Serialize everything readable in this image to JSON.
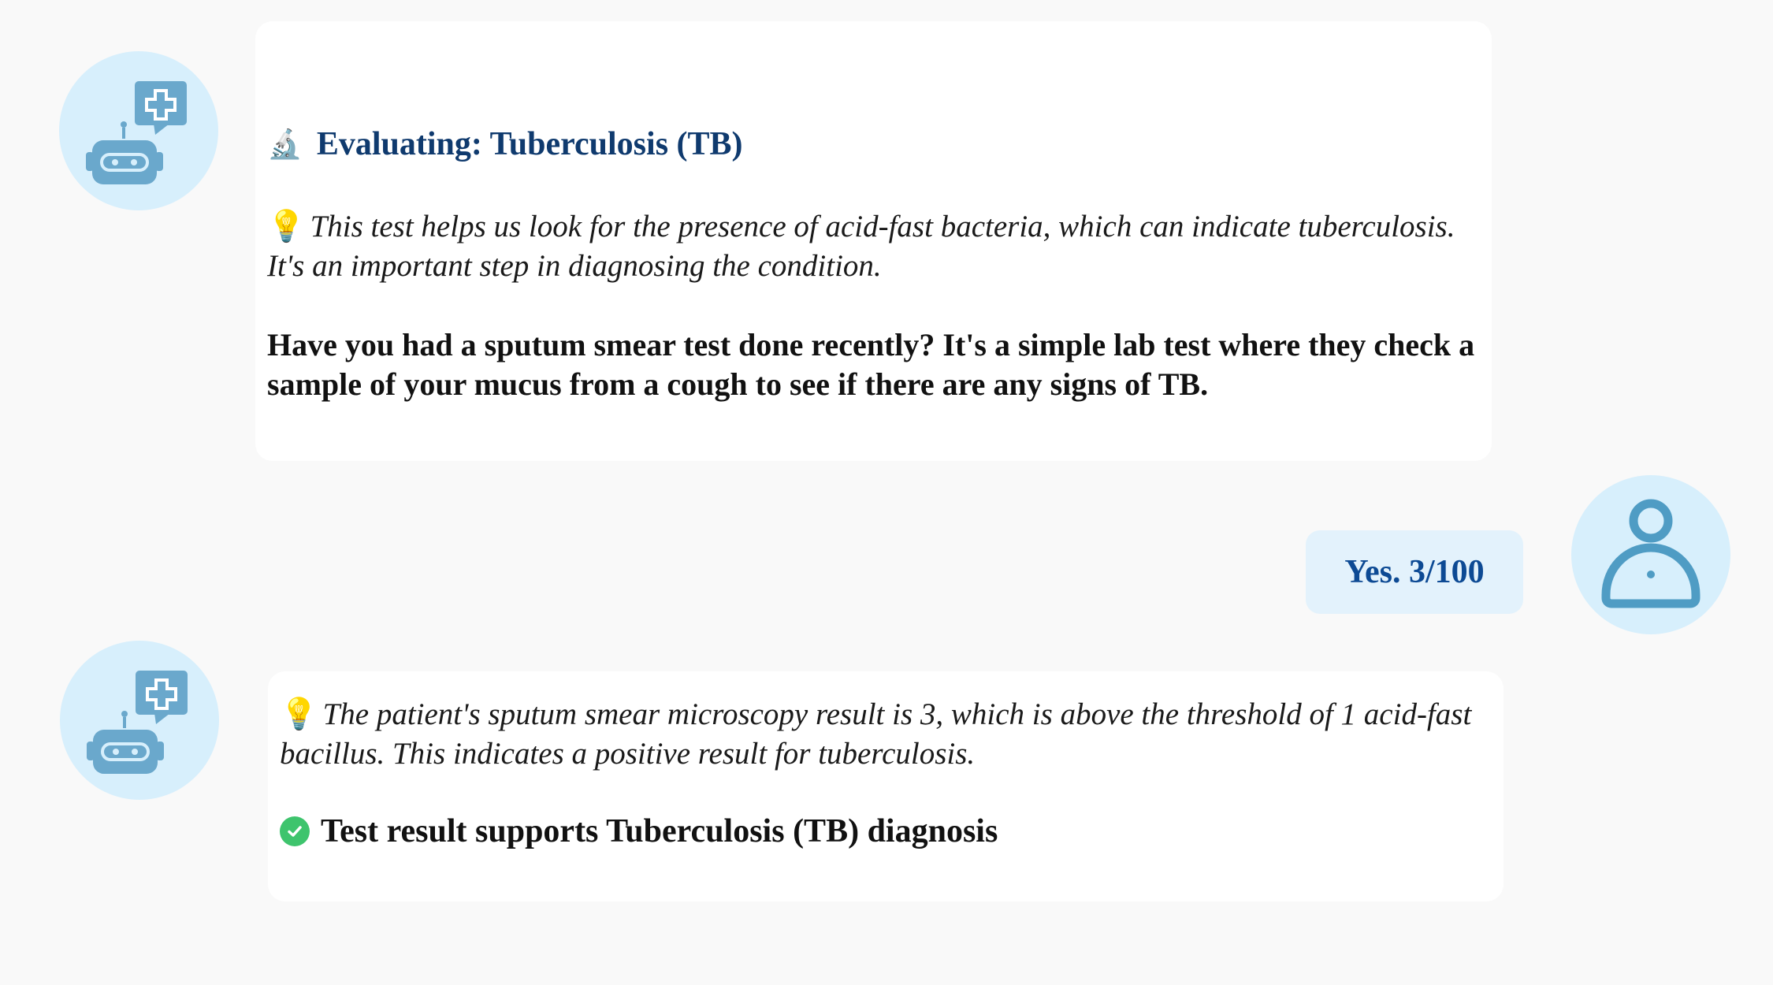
{
  "messages": [
    {
      "role": "assistant",
      "avatar_icon": "medical-bot-icon",
      "heading_icon": "microscope-icon",
      "heading": "Evaluating: Tuberculosis (TB)",
      "hint_icon": "lightbulb-icon",
      "hint": "This test helps us look for the presence of acid-fast bacteria,  which can indicate tuberculosis. It's an important step in diagnosing the condition.",
      "question": "Have you had a sputum smear test done recently? It's a simple lab test where they check a sample of your mucus from a cough to see if there are any signs of TB."
    },
    {
      "role": "user",
      "avatar_icon": "user-icon",
      "text": "Yes. 3/100"
    },
    {
      "role": "assistant",
      "avatar_icon": "medical-bot-icon",
      "hint_icon": "lightbulb-icon",
      "hint": "The patient's sputum smear microscopy result is 3, which is above the threshold of 1 acid-fast bacillus. This indicates a positive result for tuberculosis.",
      "result_icon": "check-circle-icon",
      "result": "Test result supports Tuberculosis (TB) diagnosis"
    }
  ],
  "colors": {
    "page_background": "#f9f9f9",
    "avatar_background": "#d7effc",
    "icon_blue": "#6aa8cc",
    "heading_navy": "#0f3a6e",
    "user_bubble": "#e3f2fc",
    "user_text": "#0d4a94",
    "check_green": "#3ec46d"
  }
}
